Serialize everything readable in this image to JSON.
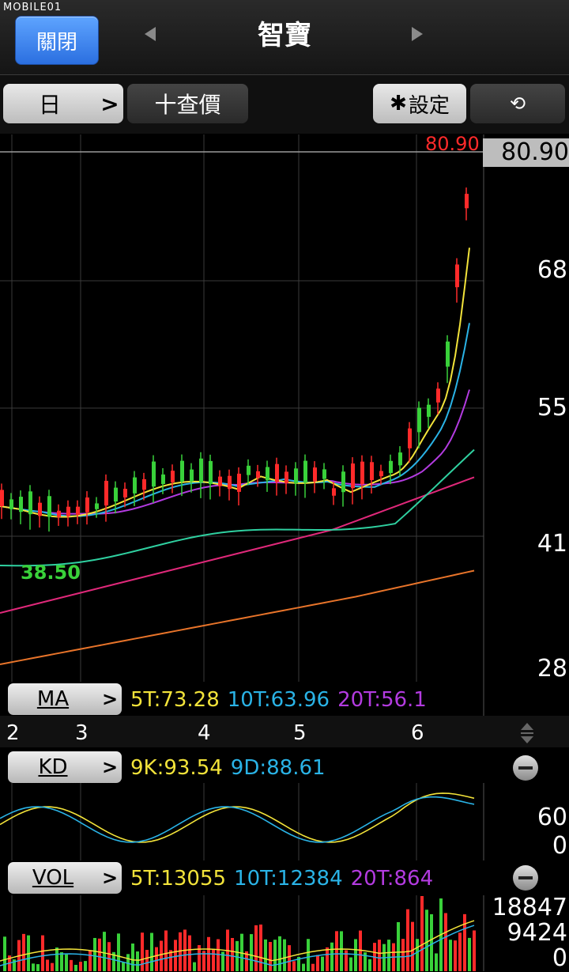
{
  "watermark": "MOBILE01",
  "header": {
    "close_label": "關閉",
    "title": "智寶"
  },
  "toolbar": {
    "period_label": "日",
    "crosshair_label": "十查價",
    "settings_label": "設定"
  },
  "main_chart": {
    "price_high_label": "80.90",
    "current_price": "80.90",
    "low_label": "38.50",
    "y_axis": [
      "68",
      "55",
      "41",
      "28"
    ],
    "x_axis": [
      "2",
      "3",
      "4",
      "5",
      "6"
    ]
  },
  "ma": {
    "label": "MA",
    "values": [
      "5T:73.28",
      "10T:63.96",
      "20T:56.1"
    ]
  },
  "kd": {
    "label": "KD",
    "values": [
      "9K:93.54",
      "9D:88.61"
    ],
    "y_axis": [
      "60",
      "0"
    ]
  },
  "vol": {
    "label": "VOL",
    "values": [
      "5T:13055",
      "10T:12384",
      "20T:864"
    ],
    "y_axis": [
      "18847",
      "9424",
      "0"
    ]
  },
  "colors": {
    "ma5": "#f2e33a",
    "ma10": "#2ab3e6",
    "ma20": "#b33be0",
    "up": "#ff2a2a",
    "down": "#39d13a",
    "low_label": "#39d13a"
  }
}
